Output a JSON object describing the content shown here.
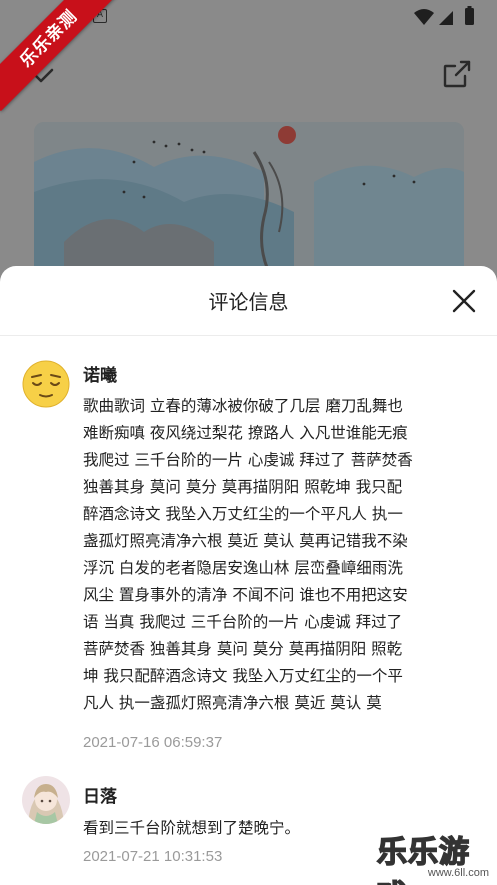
{
  "status_bar": {
    "a_icon": "A",
    "icons": [
      "wifi-icon",
      "signal-icon",
      "battery-icon"
    ]
  },
  "player": {
    "collapse_icon": "chevron-down-icon",
    "share_icon": "share-icon"
  },
  "ribbon": {
    "text": "乐乐亲测"
  },
  "sheet": {
    "title": "评论信息",
    "close_icon": "close-icon",
    "comments": [
      {
        "user": "诺曦",
        "avatar": "emoji-relieved-avatar",
        "lines": [
          "歌曲歌词  立春的薄冰被你破了几层  磨刀乱舞也",
          "难断痴嗔  夜风绕过梨花 撩路人  入凡世谁能无痕",
          "我爬过 三千台阶的一片 心虔诚  拜过了 菩萨焚香",
          "独善其身  莫问 莫分 莫再描阴阳 照乾坤  我只配",
          "醉酒念诗文  我坠入万丈红尘的一个平凡人  执一",
          "盏孤灯照亮清净六根  莫近 莫认 莫再记错我不染",
          "浮沉  白发的老者隐居安逸山林  层峦叠嶂细雨洗",
          "风尘  置身事外的清净 不闻不问  谁也不用把这安",
          "语 当真  我爬过 三千台阶的一片 心虔诚  拜过了",
          "菩萨焚香 独善其身  莫问 莫分 莫再描阴阳 照乾",
          "坤  我只配醉酒念诗文  我坠入万丈红尘的一个平",
          "凡人  执一盏孤灯照亮清净六根  莫近 莫认 莫"
        ],
        "time": "2021-07-16 06:59:37"
      },
      {
        "user": "日落",
        "avatar": "anime-girl-avatar",
        "lines": [
          "看到三千台阶就想到了楚晚宁。"
        ],
        "time": "2021-07-21 10:31:53"
      }
    ]
  },
  "watermark": {
    "text": "乐乐游戏",
    "url": "www.6ll.com"
  },
  "colors": {
    "overlay": "#8a8a8a",
    "sheet_bg": "#ffffff",
    "ribbon": "#c8101a",
    "time_text": "#9a9a9a"
  }
}
